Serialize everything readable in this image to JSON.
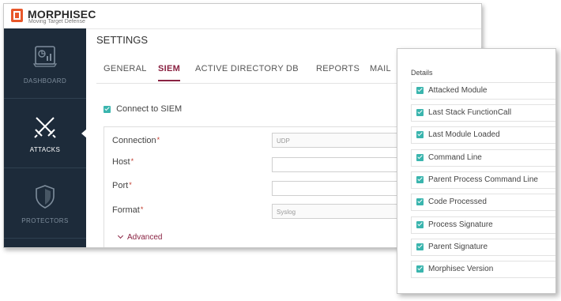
{
  "brand": {
    "name": "MORPHISEC",
    "tagline": "Moving Target Defense",
    "accent": "#e8572a"
  },
  "sidebar": {
    "background": "#1d2b3a",
    "items": [
      {
        "label": "DASHBOARD",
        "icon": "dashboard-icon",
        "active": false
      },
      {
        "label": "ATTACKS",
        "icon": "crossed-swords-icon",
        "active": true
      },
      {
        "label": "PROTECTORS",
        "icon": "shield-icon",
        "active": false
      }
    ]
  },
  "page": {
    "title": "SETTINGS"
  },
  "tabs": [
    {
      "label": "GENERAL",
      "active": false
    },
    {
      "label": "SIEM",
      "active": true
    },
    {
      "label": "ACTIVE DIRECTORY",
      "active": false
    },
    {
      "label": "DB",
      "active": false
    },
    {
      "label": "REPORTS",
      "active": false
    },
    {
      "label": "MAIL",
      "active": false
    }
  ],
  "siem": {
    "connect_label": "Connect to SIEM",
    "connect_checked": true,
    "required_mark": "*",
    "fields": [
      {
        "label": "Connection",
        "value": "UDP"
      },
      {
        "label": "Host",
        "value": ""
      },
      {
        "label": "Port",
        "value": ""
      },
      {
        "label": "Format",
        "value": "Syslog"
      }
    ],
    "advanced_label": "Advanced"
  },
  "details": {
    "title": "Details",
    "items": [
      {
        "label": "Attacked Module",
        "checked": true
      },
      {
        "label": "Last Stack FunctionCall",
        "checked": true
      },
      {
        "label": "Last Module Loaded",
        "checked": true
      },
      {
        "label": "Command Line",
        "checked": true
      },
      {
        "label": "Parent Process Command Line",
        "checked": true
      },
      {
        "label": "Code Processed",
        "checked": true
      },
      {
        "label": "Process Signature",
        "checked": true
      },
      {
        "label": "Parent Signature",
        "checked": true
      },
      {
        "label": "Morphisec Version",
        "checked": true
      }
    ]
  },
  "colors": {
    "checkbox": "#3ab5ae",
    "active_tab": "#8a2242",
    "required": "#c0392b"
  }
}
